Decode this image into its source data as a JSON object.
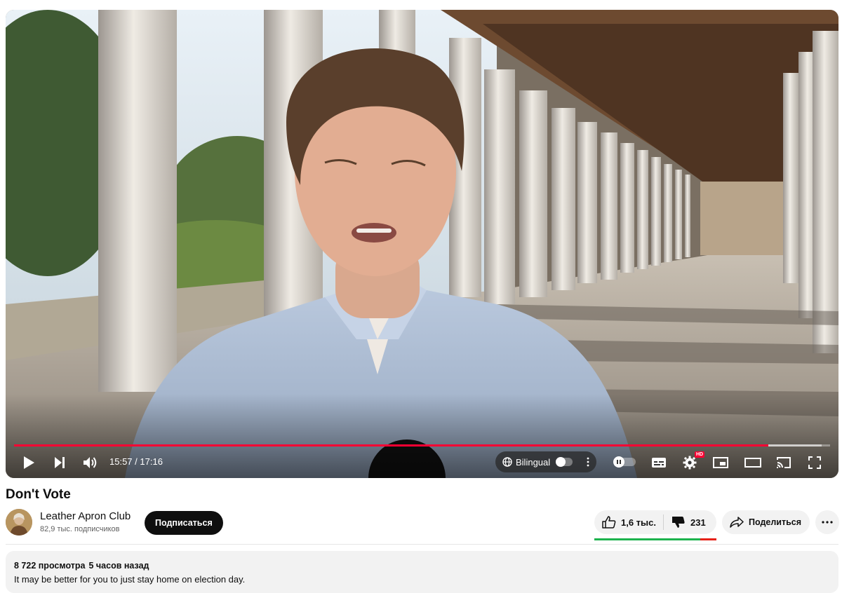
{
  "player": {
    "time_current": "15:57",
    "time_total": "17:16",
    "progress_played": 0.924,
    "progress_buffered": 0.99,
    "bilingual_label": "Bilingual",
    "hd_badge": "HD",
    "accent_color": "#ff0033",
    "icons": [
      "play-icon",
      "next-icon",
      "volume-icon",
      "globe-icon",
      "more-vertical-icon",
      "autoplay-pause-icon",
      "subtitles-icon",
      "settings-gear-icon",
      "miniplayer-icon",
      "theater-mode-icon",
      "cast-icon",
      "fullscreen-icon"
    ]
  },
  "video": {
    "title": "Don't Vote"
  },
  "channel": {
    "name": "Leather Apron Club",
    "subscribers": "82,9 тыс. подписчиков",
    "subscribe_label": "Подписаться"
  },
  "actions": {
    "likes": "1,6 тыс.",
    "dislikes": "231",
    "like_ratio": 0.87,
    "share_label": "Поделиться"
  },
  "description": {
    "views": "8 722 просмотра",
    "published": "5 часов назад",
    "text": "It may be better for you to just stay home on election day."
  }
}
